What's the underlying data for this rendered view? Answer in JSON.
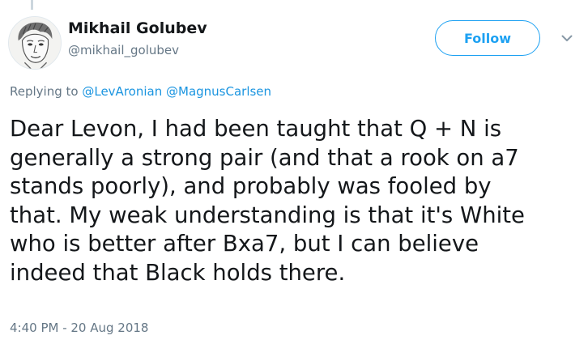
{
  "tweet": {
    "author": {
      "display_name": "Mikhail Golubev",
      "screen_name": "@mikhail_golubev",
      "avatar_icon": "avatar-portrait-sketch"
    },
    "follow_label": "Follow",
    "caret_icon": "chevron-down-icon",
    "reply_context": {
      "prefix": "Replying to",
      "mentions": [
        "@LevAronian",
        "@MagnusCarlsen"
      ]
    },
    "text_lines": [
      "Dear Levon, I had been taught that Q + N is",
      "generally a strong pair (and that a rook on a7",
      "stands poorly), and probably was fooled by",
      "that. My weak understanding is that it's White",
      "who is better after Bxa7, but I can believe",
      "indeed that Black holds there."
    ],
    "timestamp": "4:40 PM - 20 Aug 2018"
  },
  "colors": {
    "link": "#1b95e0",
    "accent": "#1da1f2",
    "secondary_text": "#657786",
    "primary_text": "#14171a"
  }
}
